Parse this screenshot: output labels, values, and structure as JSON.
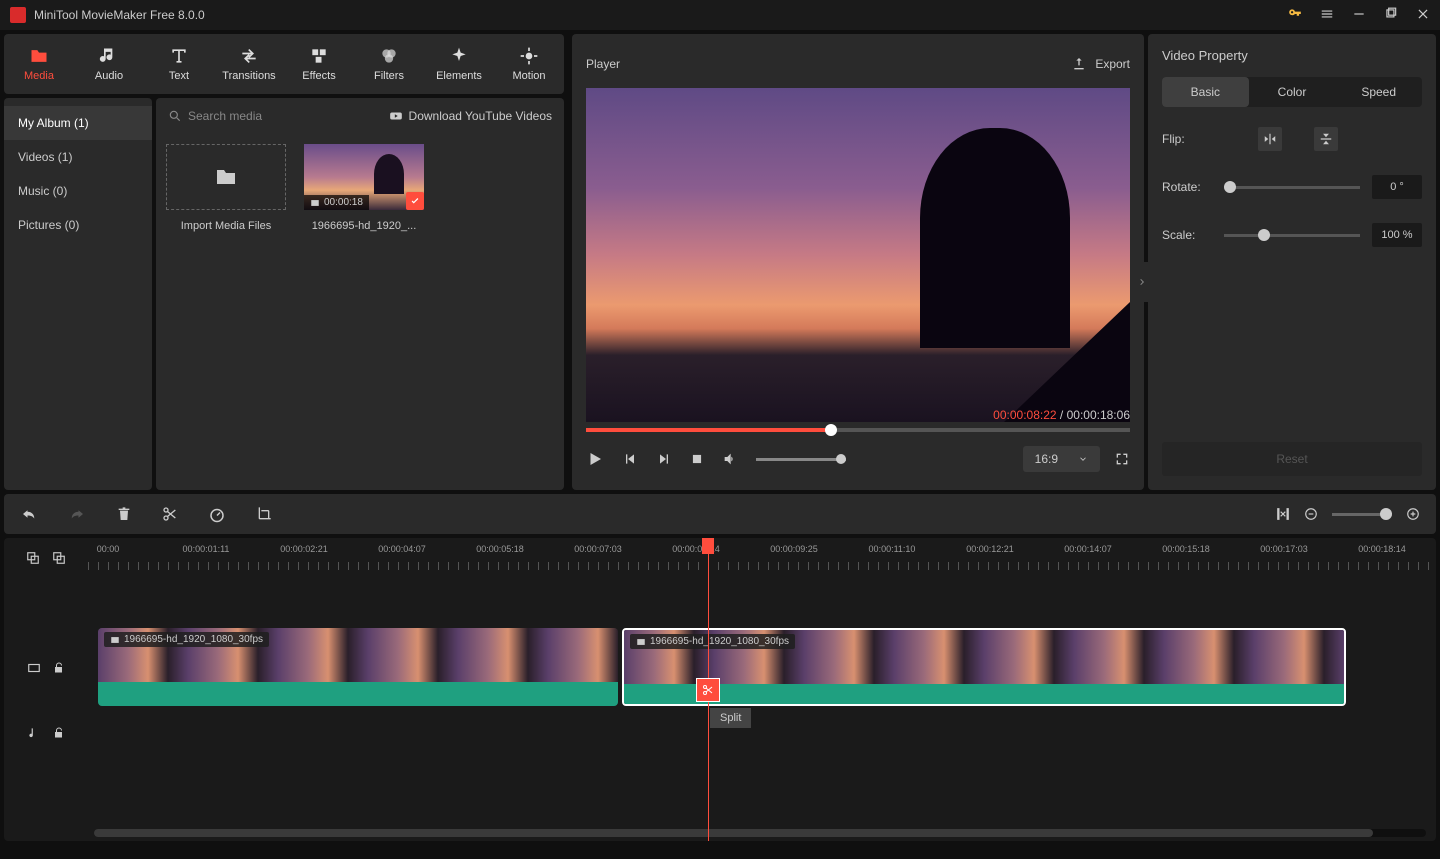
{
  "app": {
    "title": "MiniTool MovieMaker Free 8.0.0"
  },
  "tabs": {
    "media": "Media",
    "audio": "Audio",
    "text": "Text",
    "transitions": "Transitions",
    "effects": "Effects",
    "filters": "Filters",
    "elements": "Elements",
    "motion": "Motion"
  },
  "album": {
    "myalbum": "My Album (1)",
    "videos": "Videos (1)",
    "music": "Music (0)",
    "pictures": "Pictures (0)"
  },
  "media": {
    "search_placeholder": "Search media",
    "download_yt": "Download YouTube Videos",
    "import_label": "Import Media Files",
    "clip_name": "1966695-hd_1920_...",
    "clip_duration": "00:00:18"
  },
  "player": {
    "title": "Player",
    "export": "Export",
    "current_time": "00:00:08:22",
    "total_time": "00:00:18:06",
    "aspect": "16:9"
  },
  "property": {
    "title": "Video Property",
    "tab_basic": "Basic",
    "tab_color": "Color",
    "tab_speed": "Speed",
    "flip": "Flip:",
    "rotate": "Rotate:",
    "rotate_val": "0 °",
    "scale": "Scale:",
    "scale_val": "100 %",
    "reset": "Reset"
  },
  "timeline": {
    "ticks": [
      "00:00",
      "00:00:01:11",
      "00:00:02:21",
      "00:00:04:07",
      "00:00:05:18",
      "00:00:07:03",
      "00:00:08:14",
      "00:00:09:25",
      "00:00:11:10",
      "00:00:12:21",
      "00:00:14:07",
      "00:00:15:18",
      "00:00:17:03",
      "00:00:18:14"
    ],
    "clip1_name": "1966695-hd_1920_1080_30fps",
    "clip2_name": "1966695-hd_1920_1080_30fps",
    "split_tooltip": "Split"
  }
}
